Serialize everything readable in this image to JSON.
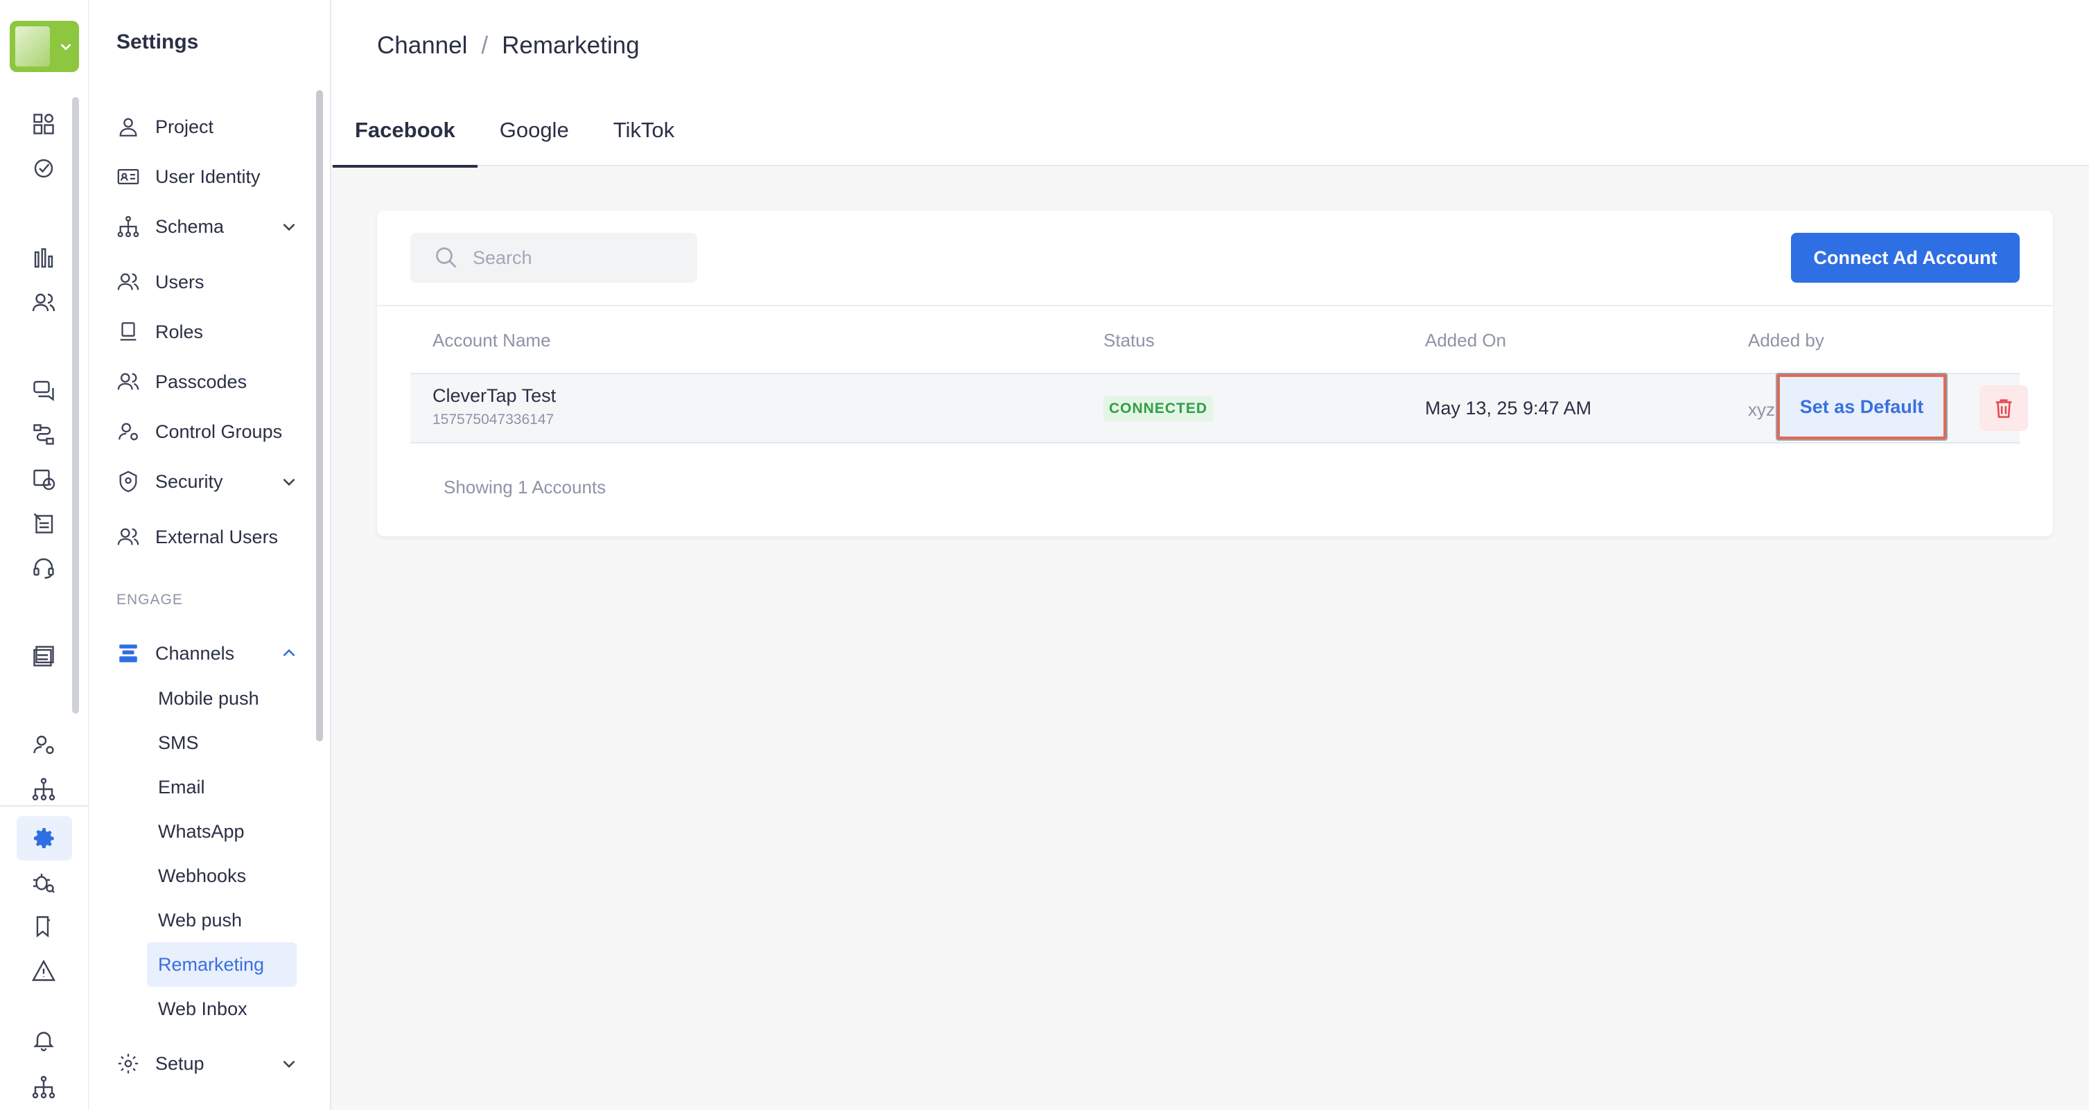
{
  "sidebar": {
    "title": "Settings",
    "items": [
      {
        "label": "Project",
        "icon": "user-icon"
      },
      {
        "label": "User Identity",
        "icon": "id-card-icon"
      },
      {
        "label": "Schema",
        "icon": "hierarchy-icon",
        "expandable": true
      },
      {
        "label": "Users",
        "icon": "users-icon"
      },
      {
        "label": "Roles",
        "icon": "stamp-icon"
      },
      {
        "label": "Passcodes",
        "icon": "users-key-icon"
      },
      {
        "label": "Control Groups",
        "icon": "user-gear-icon"
      },
      {
        "label": "Security",
        "icon": "shield-icon",
        "expandable": true
      },
      {
        "label": "External Users",
        "icon": "users-icon"
      }
    ],
    "section_label": "ENGAGE",
    "channels": {
      "label": "Channels",
      "icon": "channels-icon",
      "expanded": true
    },
    "channel_items": [
      "Mobile push",
      "SMS",
      "Email",
      "WhatsApp",
      "Webhooks",
      "Web push",
      "Remarketing",
      "Web Inbox"
    ],
    "active_channel": "Remarketing",
    "setup": {
      "label": "Setup",
      "icon": "gear-icon"
    }
  },
  "breadcrumb": {
    "parent": "Channel",
    "separator": "/",
    "current": "Remarketing"
  },
  "tabs": [
    {
      "label": "Facebook",
      "active": true
    },
    {
      "label": "Google",
      "active": false
    },
    {
      "label": "TikTok",
      "active": false
    }
  ],
  "search": {
    "placeholder": "Search",
    "value": ""
  },
  "connect_button": "Connect Ad Account",
  "table": {
    "columns": [
      "Account Name",
      "Status",
      "Added On",
      "Added by"
    ],
    "rows": [
      {
        "account_name": "CleverTap Test",
        "account_id": "157575047336147",
        "status": "CONNECTED",
        "added_on": "May 13, 25 9:47 AM",
        "added_by": "xyz"
      }
    ]
  },
  "row_actions": {
    "set_default": "Set as Default",
    "delete_icon": "trash-icon"
  },
  "footer": "Showing 1 Accounts",
  "colors": {
    "brand_green": "#8dc63f",
    "primary_blue": "#2f6fe4",
    "connected_green": "#2f9e44",
    "highlight_border": "#e06a54",
    "delete_red": "#e5484d"
  }
}
